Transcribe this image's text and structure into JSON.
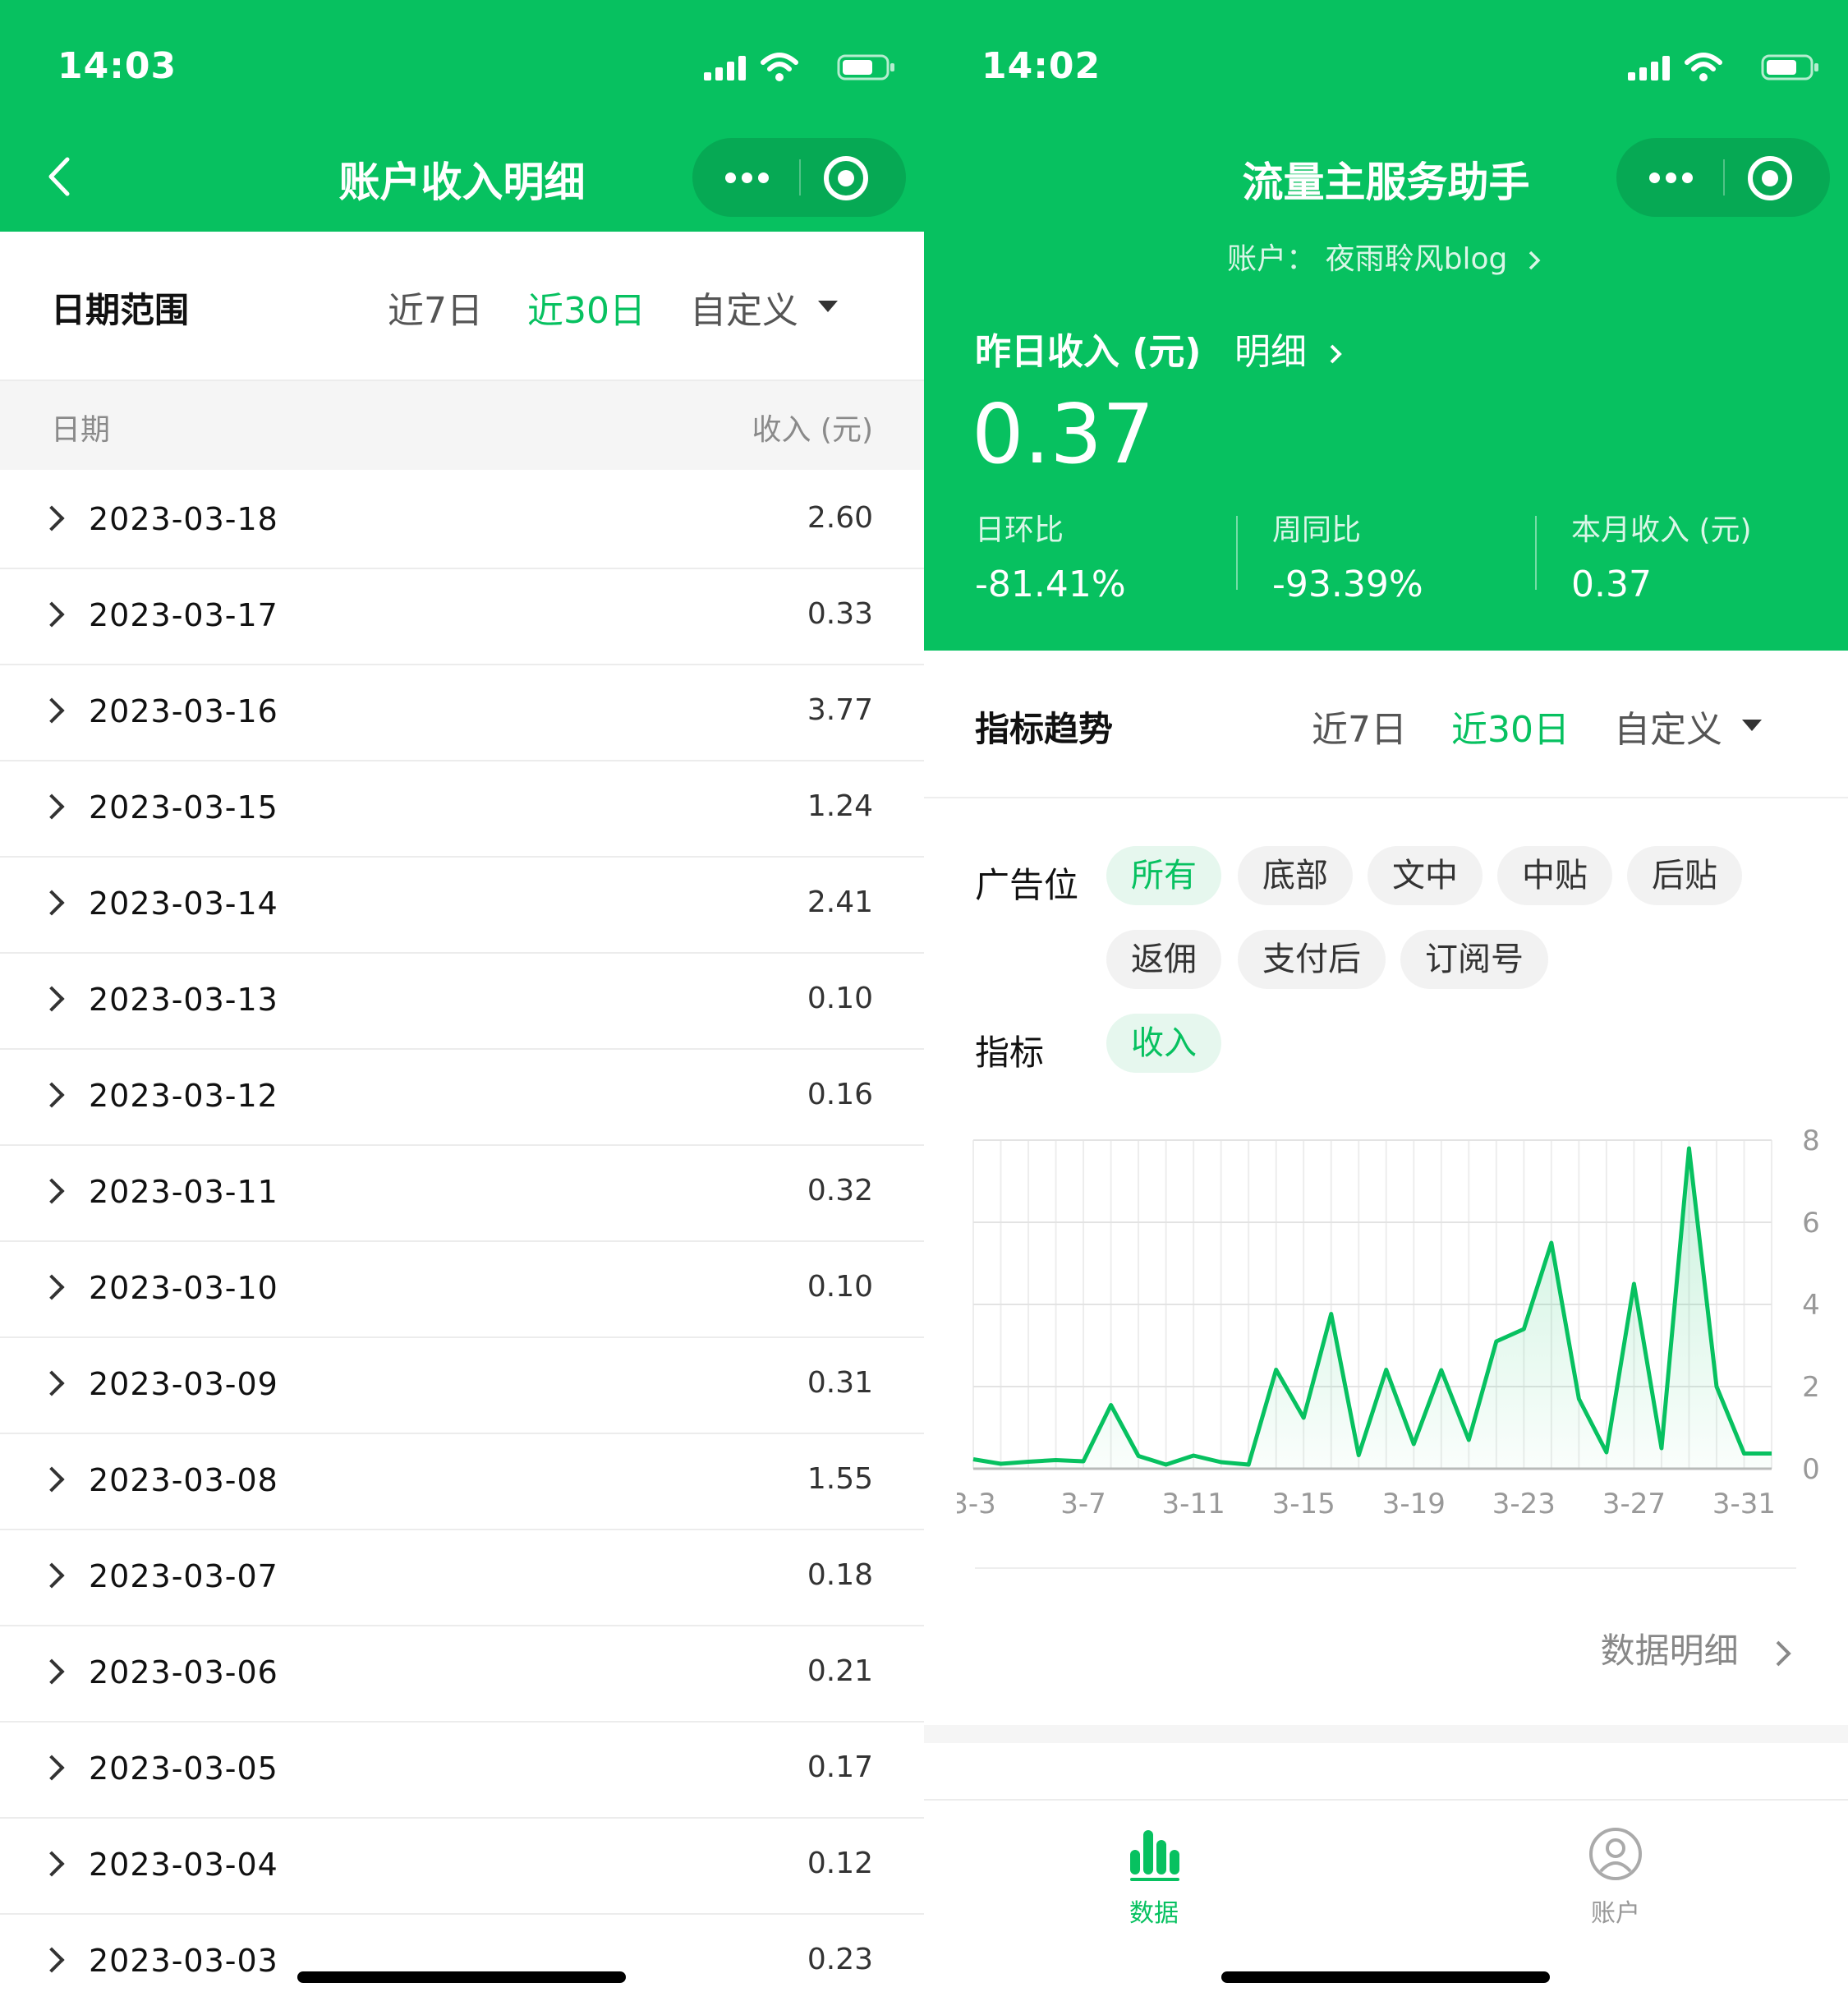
{
  "left": {
    "status_time": "14:03",
    "title": "账户收入明细",
    "filter": {
      "label": "日期范围",
      "options": [
        "近7日",
        "近30日",
        "自定义"
      ],
      "active": "近30日"
    },
    "columns": [
      "日期",
      "收入 (元)"
    ],
    "rows": [
      {
        "date": "2023-03-18",
        "value": "2.60"
      },
      {
        "date": "2023-03-17",
        "value": "0.33"
      },
      {
        "date": "2023-03-16",
        "value": "3.77"
      },
      {
        "date": "2023-03-15",
        "value": "1.24"
      },
      {
        "date": "2023-03-14",
        "value": "2.41"
      },
      {
        "date": "2023-03-13",
        "value": "0.10"
      },
      {
        "date": "2023-03-12",
        "value": "0.16"
      },
      {
        "date": "2023-03-11",
        "value": "0.32"
      },
      {
        "date": "2023-03-10",
        "value": "0.10"
      },
      {
        "date": "2023-03-09",
        "value": "0.31"
      },
      {
        "date": "2023-03-08",
        "value": "1.55"
      },
      {
        "date": "2023-03-07",
        "value": "0.18"
      },
      {
        "date": "2023-03-06",
        "value": "0.21"
      },
      {
        "date": "2023-03-05",
        "value": "0.17"
      },
      {
        "date": "2023-03-04",
        "value": "0.12"
      },
      {
        "date": "2023-03-03",
        "value": "0.23"
      }
    ]
  },
  "right": {
    "status_time": "14:02",
    "title": "流量主服务助手",
    "account": "账户： 夜雨聆风blog",
    "income_label": "昨日收入 (元)",
    "detail_link": "明细",
    "income_value": "0.37",
    "stats": [
      {
        "label": "日环比",
        "value": "-81.41%"
      },
      {
        "label": "周同比",
        "value": "-93.39%"
      },
      {
        "label": "本月收入 (元)",
        "value": "0.37"
      }
    ],
    "trend": {
      "label": "指标趋势",
      "options": [
        "近7日",
        "近30日",
        "自定义"
      ],
      "active": "近30日"
    },
    "ad_slot_label": "广告位",
    "ad_slots": [
      "所有",
      "底部",
      "文中",
      "中贴",
      "后贴",
      "返佣",
      "支付后",
      "订阅号"
    ],
    "ad_slot_active": "所有",
    "metric_label": "指标",
    "metrics": [
      "收入"
    ],
    "data_detail": "数据明细",
    "tabs": [
      {
        "label": "数据",
        "icon": "bar-chart-icon",
        "active": true
      },
      {
        "label": "账户",
        "icon": "user-icon",
        "active": false
      }
    ]
  },
  "colors": {
    "brand": "#07c160",
    "chip_active_bg": "#e6f7ee"
  },
  "chart_data": {
    "type": "area",
    "x": [
      "3-3",
      "3-4",
      "3-5",
      "3-6",
      "3-7",
      "3-8",
      "3-9",
      "3-10",
      "3-11",
      "3-12",
      "3-13",
      "3-14",
      "3-15",
      "3-16",
      "3-17",
      "3-18",
      "3-19",
      "3-20",
      "3-21",
      "3-22",
      "3-23",
      "3-24",
      "3-25",
      "3-26",
      "3-27",
      "3-28",
      "3-29",
      "3-30",
      "3-31",
      "4-1"
    ],
    "x_ticks": [
      "3-3",
      "3-7",
      "3-11",
      "3-15",
      "3-19",
      "3-23",
      "3-27",
      "3-31"
    ],
    "values": [
      0.23,
      0.12,
      0.17,
      0.21,
      0.18,
      1.55,
      0.31,
      0.1,
      0.32,
      0.16,
      0.1,
      2.41,
      1.24,
      3.77,
      0.33,
      2.41,
      0.6,
      2.4,
      0.7,
      3.1,
      3.4,
      5.5,
      1.7,
      0.4,
      4.5,
      0.5,
      7.8,
      2.0,
      0.37,
      0.37
    ],
    "y_ticks": [
      0,
      2,
      4,
      6,
      8
    ],
    "ylim": [
      0,
      8
    ],
    "y_axis_side": "right",
    "grid": true
  }
}
